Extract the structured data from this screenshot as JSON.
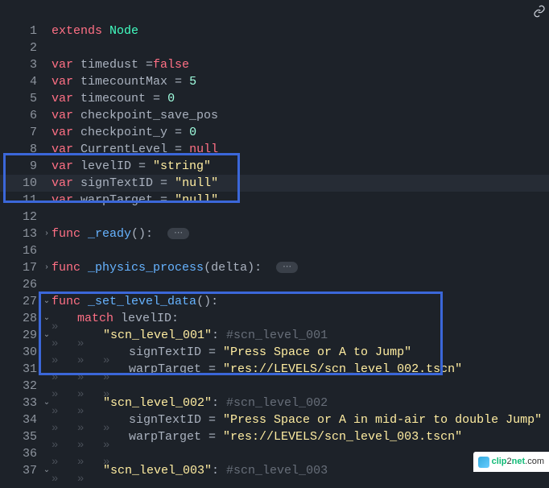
{
  "watermark": "clip2net.com",
  "code": {
    "lines": [
      {
        "n": 1,
        "fold": "",
        "indent": 0,
        "tokens": [
          [
            "kw-red",
            "extends"
          ],
          [
            "sp",
            " "
          ],
          [
            "kw-blue",
            "Node"
          ]
        ]
      },
      {
        "n": 2,
        "fold": "",
        "indent": 0,
        "tokens": []
      },
      {
        "n": 3,
        "fold": "",
        "indent": 0,
        "tokens": [
          [
            "kw-red",
            "var"
          ],
          [
            "sp",
            " "
          ],
          [
            "ident",
            "timedust ="
          ],
          [
            "lit-false",
            "false"
          ]
        ]
      },
      {
        "n": 4,
        "fold": "",
        "indent": 0,
        "tokens": [
          [
            "kw-red",
            "var"
          ],
          [
            "sp",
            " "
          ],
          [
            "ident",
            "timecountMax = "
          ],
          [
            "num",
            "5"
          ]
        ]
      },
      {
        "n": 5,
        "fold": "",
        "indent": 0,
        "tokens": [
          [
            "kw-red",
            "var"
          ],
          [
            "sp",
            " "
          ],
          [
            "ident",
            "timecount = "
          ],
          [
            "num",
            "0"
          ]
        ]
      },
      {
        "n": 6,
        "fold": "",
        "indent": 0,
        "tokens": [
          [
            "kw-red",
            "var"
          ],
          [
            "sp",
            " "
          ],
          [
            "ident",
            "checkpoint_save_pos"
          ]
        ]
      },
      {
        "n": 7,
        "fold": "",
        "indent": 0,
        "tokens": [
          [
            "kw-red",
            "var"
          ],
          [
            "sp",
            " "
          ],
          [
            "ident",
            "checkpoint_y = "
          ],
          [
            "num",
            "0"
          ]
        ]
      },
      {
        "n": 8,
        "fold": "",
        "indent": 0,
        "tokens": [
          [
            "kw-red",
            "var"
          ],
          [
            "sp",
            " "
          ],
          [
            "ident",
            "CurrentLevel = "
          ],
          [
            "lit-null",
            "null"
          ]
        ]
      },
      {
        "n": 9,
        "fold": "",
        "indent": 0,
        "tokens": [
          [
            "kw-red",
            "var"
          ],
          [
            "sp",
            " "
          ],
          [
            "ident",
            "levelID = "
          ],
          [
            "str",
            "\"string\""
          ]
        ]
      },
      {
        "n": 10,
        "fold": "",
        "indent": 0,
        "hl": true,
        "tokens": [
          [
            "kw-red",
            "var"
          ],
          [
            "sp",
            " "
          ],
          [
            "ident",
            "signTextID = "
          ],
          [
            "str",
            "\"null\""
          ]
        ]
      },
      {
        "n": 11,
        "fold": "",
        "indent": 0,
        "tokens": [
          [
            "kw-red",
            "var"
          ],
          [
            "sp",
            " "
          ],
          [
            "ident",
            "warpTarget = "
          ],
          [
            "str",
            "\"null\""
          ]
        ]
      },
      {
        "n": 12,
        "fold": "",
        "indent": 0,
        "tokens": []
      },
      {
        "n": 13,
        "fold": ">",
        "indent": 0,
        "tokens": [
          [
            "kw-red",
            "func"
          ],
          [
            "sp",
            " "
          ],
          [
            "func-name",
            "_ready"
          ],
          [
            "paren",
            "():  "
          ],
          [
            "ellipsis",
            "⋯"
          ]
        ]
      },
      {
        "n": 16,
        "fold": "",
        "indent": 0,
        "tokens": []
      },
      {
        "n": 17,
        "fold": ">",
        "indent": 0,
        "tokens": [
          [
            "kw-red",
            "func"
          ],
          [
            "sp",
            " "
          ],
          [
            "func-name",
            "_physics_process"
          ],
          [
            "paren",
            "(delta):  "
          ],
          [
            "ellipsis",
            "⋯"
          ]
        ]
      },
      {
        "n": 26,
        "fold": "",
        "indent": 0,
        "tokens": []
      },
      {
        "n": 27,
        "fold": "v",
        "indent": 0,
        "tokens": [
          [
            "kw-red",
            "func"
          ],
          [
            "sp",
            " "
          ],
          [
            "func-name",
            "_set_level_data"
          ],
          [
            "paren",
            "():"
          ]
        ]
      },
      {
        "n": 28,
        "fold": "v",
        "indent": 1,
        "tokens": [
          [
            "kw-red",
            "match"
          ],
          [
            "sp",
            " "
          ],
          [
            "ident",
            "levelID:"
          ]
        ]
      },
      {
        "n": 29,
        "fold": "v",
        "indent": 2,
        "tokens": [
          [
            "str",
            "\"scn_level_001\""
          ],
          [
            "ident",
            ": "
          ],
          [
            "comment",
            "#scn_level_001"
          ]
        ]
      },
      {
        "n": 30,
        "fold": "",
        "indent": 3,
        "tokens": [
          [
            "ident",
            "signTextID = "
          ],
          [
            "str",
            "\"Press Space or A to Jump\""
          ]
        ]
      },
      {
        "n": 31,
        "fold": "",
        "indent": 3,
        "tokens": [
          [
            "ident",
            "warpTarget = "
          ],
          [
            "str",
            "\"res://LEVELS/scn_level_002.tscn\""
          ]
        ]
      },
      {
        "n": 32,
        "fold": "",
        "indent": 3,
        "tokens": []
      },
      {
        "n": 33,
        "fold": "v",
        "indent": 2,
        "tokens": [
          [
            "str",
            "\"scn_level_002\""
          ],
          [
            "ident",
            ": "
          ],
          [
            "comment",
            "#scn_level_002"
          ]
        ]
      },
      {
        "n": 34,
        "fold": "",
        "indent": 3,
        "tokens": [
          [
            "ident",
            "signTextID = "
          ],
          [
            "str",
            "\"Press Space or A in mid-air to double Jump\""
          ]
        ]
      },
      {
        "n": 35,
        "fold": "",
        "indent": 3,
        "tokens": [
          [
            "ident",
            "warpTarget = "
          ],
          [
            "str",
            "\"res://LEVELS/scn_level_003.tscn\""
          ]
        ]
      },
      {
        "n": 36,
        "fold": "",
        "indent": 3,
        "tokens": []
      },
      {
        "n": 37,
        "fold": "v",
        "indent": 2,
        "tokens": [
          [
            "str",
            "\"scn_level_003\""
          ],
          [
            "ident",
            ": "
          ],
          [
            "comment",
            "#scn_level_003"
          ]
        ]
      }
    ]
  }
}
